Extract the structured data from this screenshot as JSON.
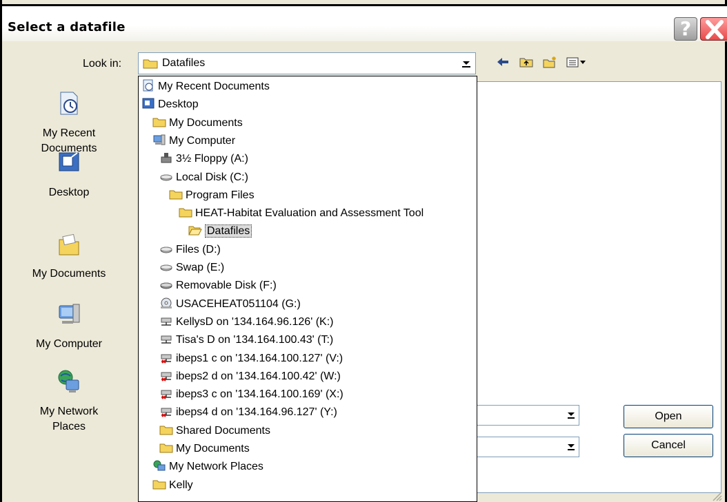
{
  "window": {
    "title": "Select a datafile"
  },
  "lookin": {
    "label": "Look in:",
    "value": "Datafiles"
  },
  "toolbar": {
    "icons": [
      "back-arrow-icon",
      "up-folder-icon",
      "new-folder-icon",
      "views-menu-icon"
    ]
  },
  "places": [
    {
      "label": "My Recent\nDocuments",
      "icon": "recent-documents-icon"
    },
    {
      "label": "Desktop",
      "icon": "desktop-icon"
    },
    {
      "label": "My Documents",
      "icon": "my-documents-icon"
    },
    {
      "label": "My Computer",
      "icon": "my-computer-icon"
    },
    {
      "label": "My Network\nPlaces",
      "icon": "network-places-icon"
    }
  ],
  "dropdown": {
    "items": [
      {
        "label": "My Recent Documents",
        "icon": "recent-documents-icon"
      },
      {
        "label": "Desktop",
        "icon": "desktop-icon"
      },
      {
        "label": "My Documents",
        "icon": "folder-icon"
      },
      {
        "label": "My Computer",
        "icon": "computer-icon"
      },
      {
        "label": "3½ Floppy (A:)",
        "icon": "floppy-icon"
      },
      {
        "label": "Local Disk (C:)",
        "icon": "disk-icon"
      },
      {
        "label": "Program Files",
        "icon": "folder-icon"
      },
      {
        "label": "HEAT-Habitat Evaluation and Assessment Tool",
        "icon": "folder-icon"
      },
      {
        "label": "Datafiles",
        "icon": "folder-open-icon",
        "selected": true
      },
      {
        "label": "Files (D:)",
        "icon": "disk-icon"
      },
      {
        "label": "Swap (E:)",
        "icon": "disk-icon"
      },
      {
        "label": "Removable Disk (F:)",
        "icon": "removable-disk-icon"
      },
      {
        "label": "USACEHEAT051104 (G:)",
        "icon": "cd-icon"
      },
      {
        "label": "KellysD on '134.164.96.126' (K:)",
        "icon": "network-drive-icon"
      },
      {
        "label": "Tisa's D on '134.164.100.43' (T:)",
        "icon": "network-drive-icon"
      },
      {
        "label": "ibeps1 c on '134.164.100.127' (V:)",
        "icon": "network-drive-disconnected-icon"
      },
      {
        "label": "ibeps2 d on '134.164.100.42' (W:)",
        "icon": "network-drive-disconnected-icon"
      },
      {
        "label": "ibeps3 c on '134.164.100.169' (X:)",
        "icon": "network-drive-disconnected-icon"
      },
      {
        "label": "ibeps4 d on '134.164.96.127' (Y:)",
        "icon": "network-drive-disconnected-icon"
      },
      {
        "label": "Shared Documents",
        "icon": "folder-icon"
      },
      {
        "label": "My Documents",
        "icon": "folder-icon"
      },
      {
        "label": "My Network Places",
        "icon": "network-places-icon"
      },
      {
        "label": "Kelly",
        "icon": "folder-icon"
      }
    ]
  },
  "buttons": {
    "open": "Open",
    "cancel": "Cancel"
  },
  "colors": {
    "selection": "#dcdcdc",
    "folder": "#f5d45e",
    "close": "#e84a4a",
    "border": "#7f9db9"
  }
}
